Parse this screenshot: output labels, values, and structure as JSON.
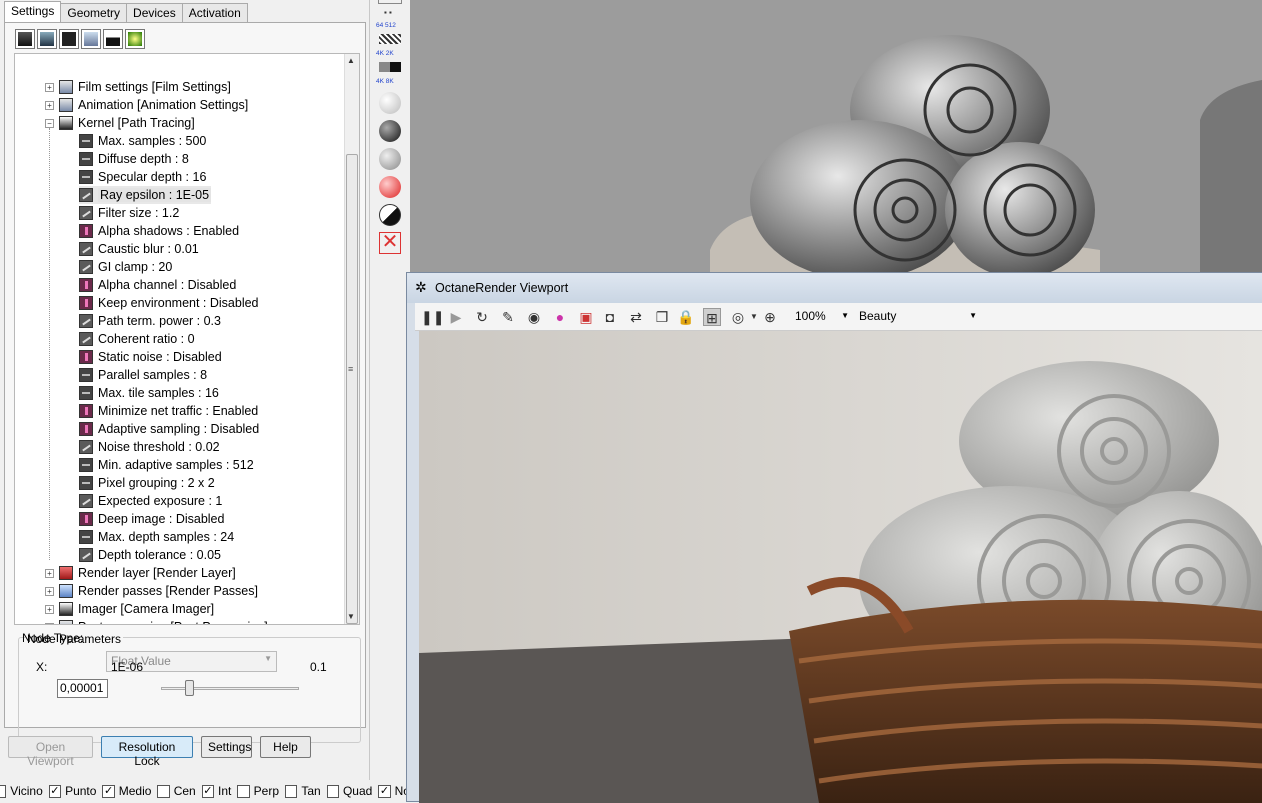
{
  "tabs": [
    "Settings",
    "Geometry",
    "Devices",
    "Activation"
  ],
  "toolbar_icons": [
    "camera-icon",
    "render-target-icon",
    "kernel-icon",
    "render-layer-icon",
    "imager-icon",
    "postprocess-icon"
  ],
  "tree": {
    "groups_top": [
      {
        "label": "Film settings  [Film Settings]",
        "icon": "grp"
      },
      {
        "label": "Animation  [Animation Settings]",
        "icon": "grp"
      },
      {
        "label": "Kernel  [Path Tracing]",
        "icon": "dk"
      }
    ],
    "kernel_items": [
      {
        "label": "Max. samples : 500",
        "icon": "num"
      },
      {
        "label": "Diffuse depth : 8",
        "icon": "num"
      },
      {
        "label": "Specular depth : 16",
        "icon": "num"
      },
      {
        "label": "Ray epsilon : 1E-05",
        "icon": "flt"
      },
      {
        "label": "Filter size : 1.2",
        "icon": "flt"
      },
      {
        "label": "Alpha shadows : Enabled",
        "icon": "bool"
      },
      {
        "label": "Caustic blur : 0.01",
        "icon": "flt"
      },
      {
        "label": "GI clamp : 20",
        "icon": "flt"
      },
      {
        "label": "Alpha channel : Disabled",
        "icon": "bool"
      },
      {
        "label": "Keep environment : Disabled",
        "icon": "bool"
      },
      {
        "label": "Path term. power : 0.3",
        "icon": "flt"
      },
      {
        "label": "Coherent ratio : 0",
        "icon": "flt"
      },
      {
        "label": "Static noise : Disabled",
        "icon": "bool"
      },
      {
        "label": "Parallel samples : 8",
        "icon": "num"
      },
      {
        "label": "Max. tile samples : 16",
        "icon": "num"
      },
      {
        "label": "Minimize net traffic : Enabled",
        "icon": "bool"
      },
      {
        "label": "Adaptive sampling : Disabled",
        "icon": "bool"
      },
      {
        "label": "Noise threshold : 0.02",
        "icon": "flt"
      },
      {
        "label": "Min. adaptive samples : 512",
        "icon": "num"
      },
      {
        "label": "Pixel grouping : 2 x 2",
        "icon": "num"
      },
      {
        "label": "Expected exposure : 1",
        "icon": "flt"
      },
      {
        "label": "Deep image : Disabled",
        "icon": "bool"
      },
      {
        "label": "Max. depth samples : 24",
        "icon": "num"
      },
      {
        "label": "Depth tolerance : 0.05",
        "icon": "flt"
      }
    ],
    "groups_bottom": [
      {
        "label": "Render layer  [Render Layer]",
        "icon": "red"
      },
      {
        "label": "Render passes  [Render Passes]",
        "icon": "blu"
      },
      {
        "label": "Imager  [Camera Imager]",
        "icon": "dk"
      },
      {
        "label": "Post processing  [Post Processing]",
        "icon": "grp"
      }
    ],
    "selected_index": 3
  },
  "node_params": {
    "title": "Node Parameters",
    "type_label": "Node Type:",
    "type_value": "Float Value",
    "x_label": "X:",
    "x_value": "0,00001",
    "min_label": "1E-06",
    "max_label": "0.1",
    "slider_fraction": 0.2
  },
  "buttons": {
    "open_viewport": "Open Viewport",
    "resolution_lock": "Resolution Lock",
    "settings": "Settings",
    "help": "Help"
  },
  "snaps": [
    {
      "label": "Vicino",
      "checked": false
    },
    {
      "label": "Punto",
      "checked": true
    },
    {
      "label": "Medio",
      "checked": true
    },
    {
      "label": "Cen",
      "checked": false
    },
    {
      "label": "Int",
      "checked": true
    },
    {
      "label": "Perp",
      "checked": false
    },
    {
      "label": "Tan",
      "checked": false
    },
    {
      "label": "Quad",
      "checked": false
    },
    {
      "label": "No",
      "checked": true
    }
  ],
  "strip_labels": [
    "64  512",
    "4K  2K",
    "4K  8K"
  ],
  "viewport": {
    "title": "OctaneRender Viewport",
    "zoom": "100%",
    "pass": "Beauty"
  },
  "colors": {
    "accent": "#3c7fb1",
    "bool_icon": "#6a2a4a",
    "render_bg": "#d8d6d2"
  }
}
